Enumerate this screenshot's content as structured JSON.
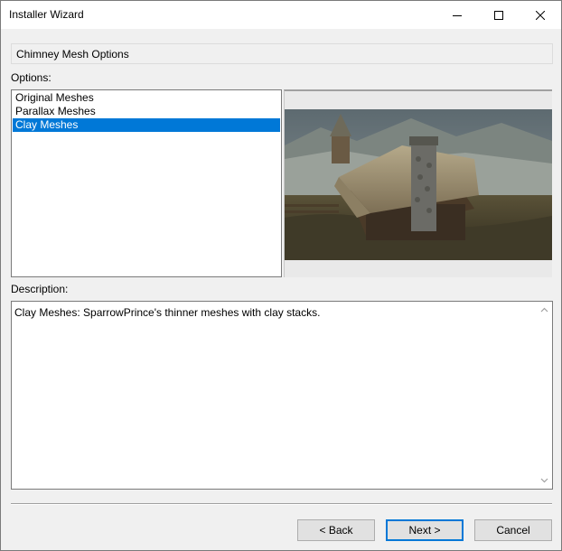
{
  "window": {
    "title": "Installer Wizard"
  },
  "step": {
    "header": "Chimney Mesh Options"
  },
  "options": {
    "label": "Options:",
    "items": [
      "Original Meshes",
      "Parallax Meshes",
      "Clay Meshes"
    ],
    "selected_index": 2
  },
  "preview": {
    "subject": "Thatched-roof house with stone chimney stack in a snowy landscape"
  },
  "description": {
    "label": "Description:",
    "text": "Clay Meshes: SparrowPrince's thinner meshes with clay stacks."
  },
  "buttons": {
    "back": "< Back",
    "next": "Next >",
    "cancel": "Cancel"
  },
  "colors": {
    "selection": "#0078d7",
    "default_button_border": "#0078d7"
  }
}
